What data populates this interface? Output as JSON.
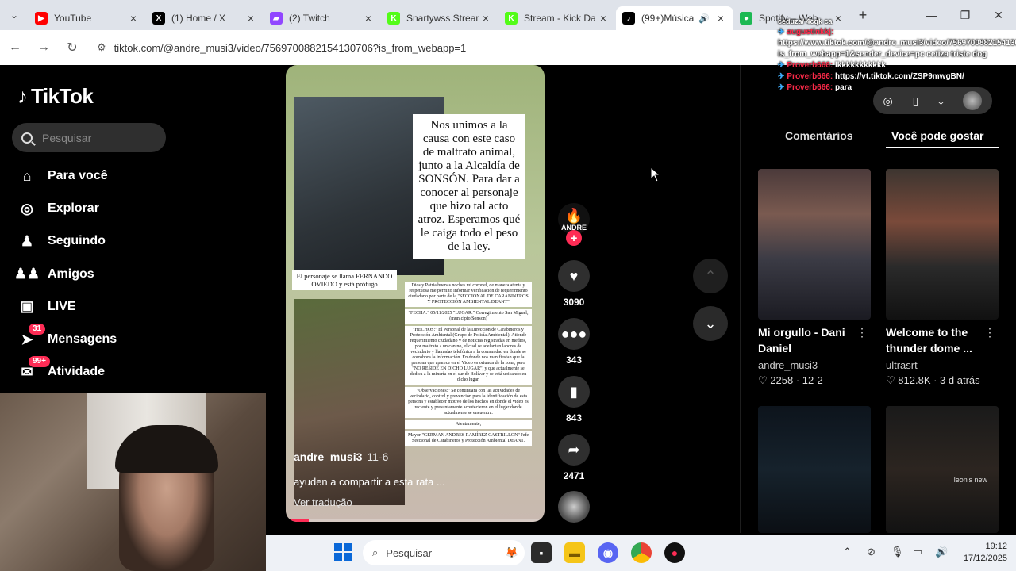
{
  "browser": {
    "tabs": [
      {
        "label": "YouTube",
        "color": "#ff0000",
        "glyph": "▶"
      },
      {
        "label": "(1) Home / X",
        "color": "#000000",
        "glyph": "X"
      },
      {
        "label": "(2) Twitch",
        "color": "#9146ff",
        "glyph": "▰"
      },
      {
        "label": "Snartywss Stream",
        "color": "#53fc18",
        "glyph": "K"
      },
      {
        "label": "Stream - Kick Da",
        "color": "#53fc18",
        "glyph": "K"
      },
      {
        "label": "(99+)Música",
        "color": "#000000",
        "glyph": "♪",
        "active": true
      },
      {
        "label": "Spotify – Web",
        "color": "#1db954",
        "glyph": "●"
      }
    ],
    "url": "tiktok.com/@andre_musi3/video/7569700882154130706?is_from_webapp=1"
  },
  "chat": {
    "top_text": "ceduza/ 4cqk ca",
    "messages": [
      {
        "user": "augustinkkj:",
        "user_color": "#ff2a4a",
        "text": "https://www.tiktok.com/@andre_musi3/video/7569700882154130706?is_from_webapp=1&sender_device=pc cetiza triste dog"
      },
      {
        "user": "Proverb666:",
        "user_color": "#ff2a4a",
        "text": "lkkkkkkkkkkk"
      },
      {
        "user": "Proverb666:",
        "user_color": "#ff2a4a",
        "text": "https://vt.tiktok.com/ZSP9mwgBN/"
      },
      {
        "user": "Proverb666:",
        "user_color": "#ff2a4a",
        "text": "para"
      }
    ]
  },
  "tiktok": {
    "logo": "TikTok",
    "search_placeholder": "Pesquisar",
    "nav": [
      {
        "label": "Para você",
        "icon": "home-icon",
        "glyph": "⌂"
      },
      {
        "label": "Explorar",
        "icon": "compass-icon",
        "glyph": "◎"
      },
      {
        "label": "Seguindo",
        "icon": "following-icon",
        "glyph": "♟"
      },
      {
        "label": "Amigos",
        "icon": "friends-icon",
        "glyph": "♟♟"
      },
      {
        "label": "LIVE",
        "icon": "live-icon",
        "glyph": "▣"
      },
      {
        "label": "Mensagens",
        "icon": "messages-icon",
        "glyph": "➤",
        "badge": "31"
      },
      {
        "label": "Atividade",
        "icon": "activity-icon",
        "glyph": "✉",
        "badge": "99+"
      }
    ]
  },
  "video": {
    "overlay_text": "Nos unimos a la causa con este caso de maltrato animal, junto a la Alcaldía de SONSÓN. Para dar a conocer al personaje que hizo tal acto atroz. Esperamos qué le caiga todo el peso de la ley.",
    "caption_person": "El personaje se llama FERNANDO OVIEDO y está prófugo",
    "doc_blocks": [
      "Dios y Patria buenas noches mi coronel, de manera atenta y respetuosa me permito informar verificación de requerimiento ciudadano por parte de la \"SECCIONAL DE CARABINEROS Y PROTECCIÓN AMBIENTAL DEANT\"",
      "\"FECHA:\" 05/11/2025 \"LUGAR:\" Corregimiento San Miguel, (municipio Sonson)",
      "\"HECHOS:\" El Personal de la Dirección de Carabineros y Protección Ambiental (Grupo de Policía Ambiental), Atiende requerimiento ciudadano y de noticias registradas en medios, por maltrato a un canino, el cual se adelantan labores de vecindario y llamadas telefónica a la comunidad en donde se corrobora la información. En donde nos manifiestan que la persona que aparece en el Video es oriunda de la zona, pero \"NO RESIDE EN DICHO LUGAR\", y que actualmente se dedica a la minería en el sur de Bolívar y se está ubicando en dicho lugar.",
      "\"Observaciones:\" Se continuara con las actividades de vecindario, control y prevención para la identificación de esta persona y establecer motivo de los hechos en donde el video es reciente y presuntamente acontecieron en el lugar donde actualmente se encuentra.",
      "Atentamente,",
      "Mayor \"GERMAN ANDRES RAMÍREZ CASTRILLON\" Jefe Seccional de Carabineros y Protección Ambiental DEANT."
    ],
    "author": "andre_musi3",
    "date": "11-6",
    "description": "ayuden a compartir a esta rata ...",
    "translate": "Ver tradução",
    "progress": 0.09,
    "creator_label": "ANDRE",
    "likes": "3090",
    "comments": "343",
    "saves": "843",
    "shares": "2471"
  },
  "right_panel": {
    "tab_comments": "Comentários",
    "tab_like": "Você pode gostar",
    "cards": [
      {
        "title": "Mi orgullo - Dani Daniel",
        "author": "andre_musi3",
        "likes": "2258",
        "date": "12-2",
        "bg": "linear-gradient(180deg,#4b3a3a 0%,#7a5a50 30%,#3b3b45 60%,#1b1b22 100%)"
      },
      {
        "title": "Welcome to the thunder dome ...",
        "author": "ultrasrt",
        "likes": "812.8K",
        "date": "3 d atrás",
        "bg": "linear-gradient(180deg,#3d3530 0%,#7a4a3a 35%,#2a2a2a 65%,#111 100%)"
      },
      {
        "title": "",
        "author": "",
        "likes": "",
        "date": "",
        "bg": "linear-gradient(180deg,#0d141c 0%,#16222c 50%,#0b0f14 100%)"
      },
      {
        "title": "",
        "author": "",
        "likes": "",
        "date": "",
        "bg": "linear-gradient(180deg,#1a1a1a 0%,#2c2520 50%,#121212 100%)",
        "overlay": "leon's new"
      }
    ]
  },
  "taskbar": {
    "search_placeholder": "Pesquisar",
    "time": "19:12",
    "date": "17/12/2025"
  }
}
